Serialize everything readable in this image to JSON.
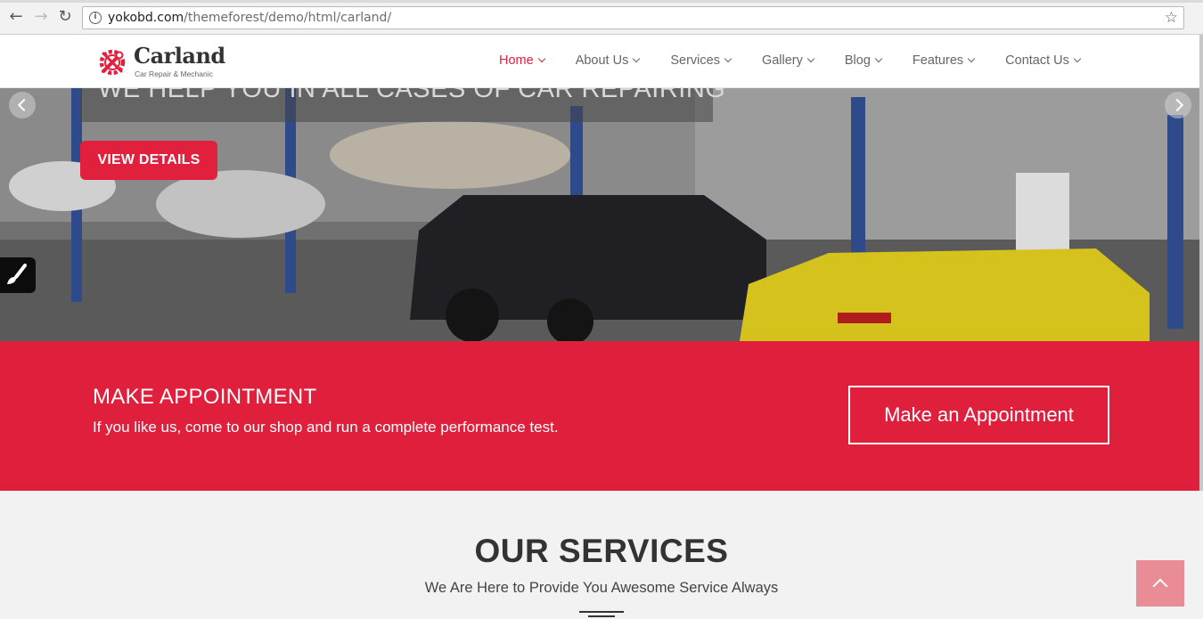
{
  "browser": {
    "url_host": "yokobd.com",
    "url_path": "/themeforest/demo/html/carland/",
    "icons": [
      "back-arrow-icon",
      "forward-arrow-icon",
      "reload-icon",
      "info-icon",
      "star-icon"
    ]
  },
  "header": {
    "logo_title": "Carland",
    "logo_tagline": "Car Repair & Mechanic",
    "nav": [
      {
        "label": "Home",
        "active": true
      },
      {
        "label": "About Us",
        "active": false
      },
      {
        "label": "Services",
        "active": false
      },
      {
        "label": "Gallery",
        "active": false
      },
      {
        "label": "Blog",
        "active": false
      },
      {
        "label": "Features",
        "active": false
      },
      {
        "label": "Contact Us",
        "active": false
      }
    ]
  },
  "hero": {
    "headline": "WE HELP YOU IN ALL CASES OF CAR REPAIRING",
    "button_label": "VIEW DETAILS"
  },
  "appointment": {
    "title": "MAKE APPOINTMENT",
    "text": "If you like us, come to our shop and run a complete performance test.",
    "button_label": "Make an Appointment"
  },
  "services": {
    "title": "OUR SERVICES",
    "subtitle": "We Are Here to Provide You Awesome Service Always"
  },
  "colors": {
    "brand_red": "#e0203d",
    "back_to_top": "#e98c95"
  }
}
